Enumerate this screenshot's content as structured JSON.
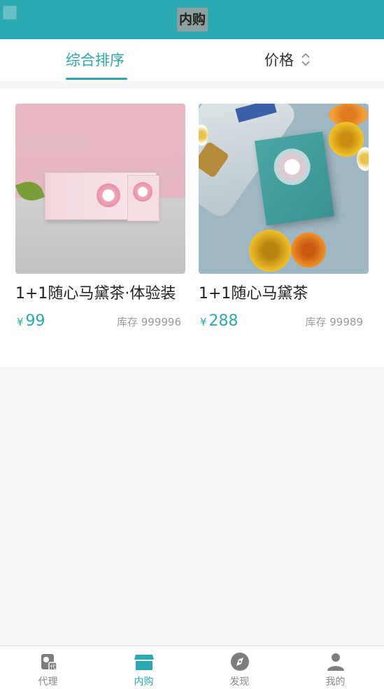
{
  "header": {
    "title": "内购"
  },
  "sort_tabs": [
    {
      "label": "综合排序",
      "active": true
    },
    {
      "label": "价格",
      "active": false
    }
  ],
  "products": [
    {
      "name": "1+1随心马黛茶·体验装",
      "currency": "¥",
      "price": "99",
      "stock": "库存 999996"
    },
    {
      "name": "1+1随心马黛茶",
      "currency": "¥",
      "price": "288",
      "stock": "库存 99989"
    }
  ],
  "tabbar": [
    {
      "label": "代理",
      "icon": "agent-icon",
      "active": false
    },
    {
      "label": "内购",
      "icon": "shop-icon",
      "active": true
    },
    {
      "label": "发现",
      "icon": "compass-icon",
      "active": false
    },
    {
      "label": "我的",
      "icon": "user-icon",
      "active": false
    }
  ],
  "colors": {
    "accent": "#2aa9b1",
    "text": "#222222",
    "muted": "#999999",
    "page_bg": "#f6f6f6"
  }
}
